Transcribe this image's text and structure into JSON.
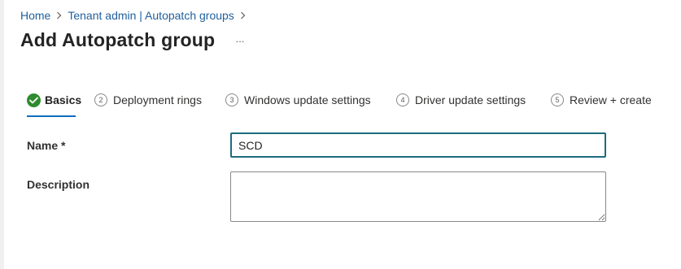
{
  "breadcrumb": {
    "items": [
      {
        "label": "Home"
      },
      {
        "label": "Tenant admin | Autopatch groups"
      }
    ]
  },
  "page": {
    "title": "Add Autopatch group",
    "more_label": "..."
  },
  "tabs": [
    {
      "label": "Basics",
      "step": "",
      "state": "completed",
      "icon": "check-circle-icon"
    },
    {
      "label": "Deployment rings",
      "step": "2",
      "state": "pending"
    },
    {
      "label": "Windows update settings",
      "step": "3",
      "state": "pending"
    },
    {
      "label": "Driver update settings",
      "step": "4",
      "state": "pending"
    },
    {
      "label": "Review + create",
      "step": "5",
      "state": "pending"
    }
  ],
  "form": {
    "name": {
      "label": "Name *",
      "value": "SCD"
    },
    "description": {
      "label": "Description",
      "value": ""
    }
  },
  "colors": {
    "accent": "#0f6cbd",
    "success": "#2e8b2e",
    "input_focus_border": "#1e6b7f"
  }
}
